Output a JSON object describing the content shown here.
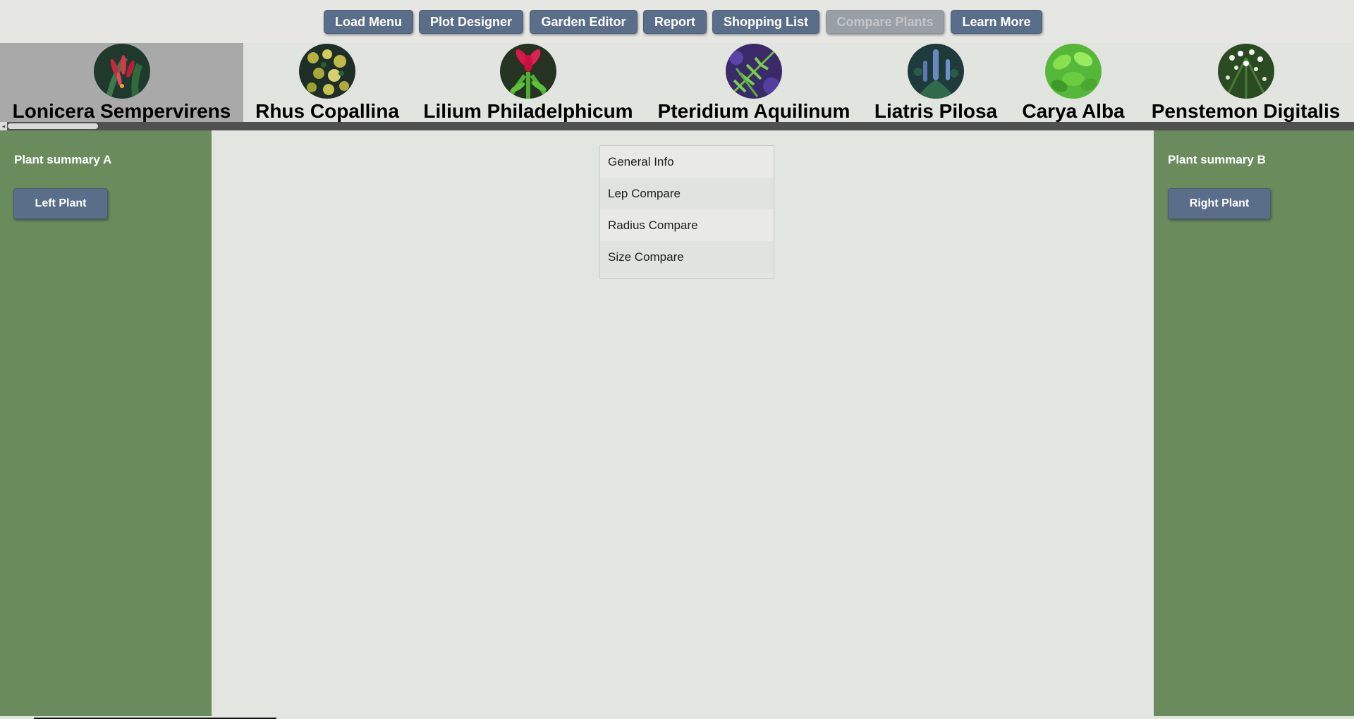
{
  "nav": {
    "buttons": [
      {
        "label": "Load Menu",
        "enabled": true
      },
      {
        "label": "Plot Designer",
        "enabled": true
      },
      {
        "label": "Garden Editor",
        "enabled": true
      },
      {
        "label": "Report",
        "enabled": true
      },
      {
        "label": "Shopping List",
        "enabled": true
      },
      {
        "label": "Compare Plants",
        "enabled": false
      },
      {
        "label": "Learn More",
        "enabled": true
      }
    ]
  },
  "plants": [
    {
      "name": "Lonicera Sempervirens",
      "selected": true,
      "image": "red-tubular-flowers"
    },
    {
      "name": "Rhus Copallina",
      "selected": false,
      "image": "yellow-flower-clusters"
    },
    {
      "name": "Lilium Philadelphicum",
      "selected": false,
      "image": "red-lily"
    },
    {
      "name": "Pteridium Aquilinum",
      "selected": false,
      "image": "fern-fronds"
    },
    {
      "name": "Liatris Pilosa",
      "selected": false,
      "image": "blue-spikes"
    },
    {
      "name": "Carya Alba",
      "selected": false,
      "image": "green-leaves"
    },
    {
      "name": "Penstemon Digitalis",
      "selected": false,
      "image": "white-flowers"
    }
  ],
  "left_panel": {
    "title": "Plant summary A",
    "button": "Left Plant"
  },
  "right_panel": {
    "title": "Plant summary B",
    "button": "Right Plant"
  },
  "compare_menu": {
    "items": [
      "General Info",
      "Lep Compare",
      "Radius Compare",
      "Size Compare"
    ]
  },
  "colors": {
    "nav_button": "#5a6e8a",
    "side_panel": "#6a8b5c",
    "background": "#e3e5e0",
    "selected_plant": "#a9a9a9"
  }
}
